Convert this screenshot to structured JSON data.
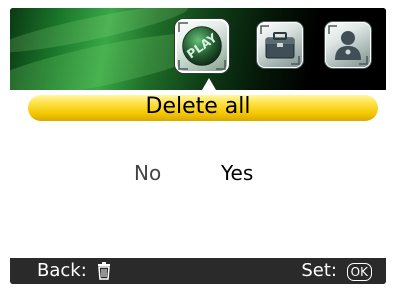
{
  "header": {
    "tabs": [
      {
        "name": "play-tab",
        "label": "PLAY",
        "icon": "play-icon",
        "selected": true
      },
      {
        "name": "tools-tab",
        "label": "",
        "icon": "toolbox-icon",
        "selected": false
      },
      {
        "name": "person-tab",
        "label": "",
        "icon": "person-icon",
        "selected": false
      }
    ]
  },
  "dialog": {
    "title": "Delete all",
    "options": {
      "no": "No",
      "yes": "Yes"
    },
    "selected_option": "Yes"
  },
  "footer": {
    "back_label": "Back:",
    "back_icon": "trash-icon",
    "set_label": "Set:",
    "set_key": "OK"
  },
  "colors": {
    "title_bar": "#f5c800",
    "header_green": "#3aa847",
    "footer_bg": "#2a2a2a"
  }
}
